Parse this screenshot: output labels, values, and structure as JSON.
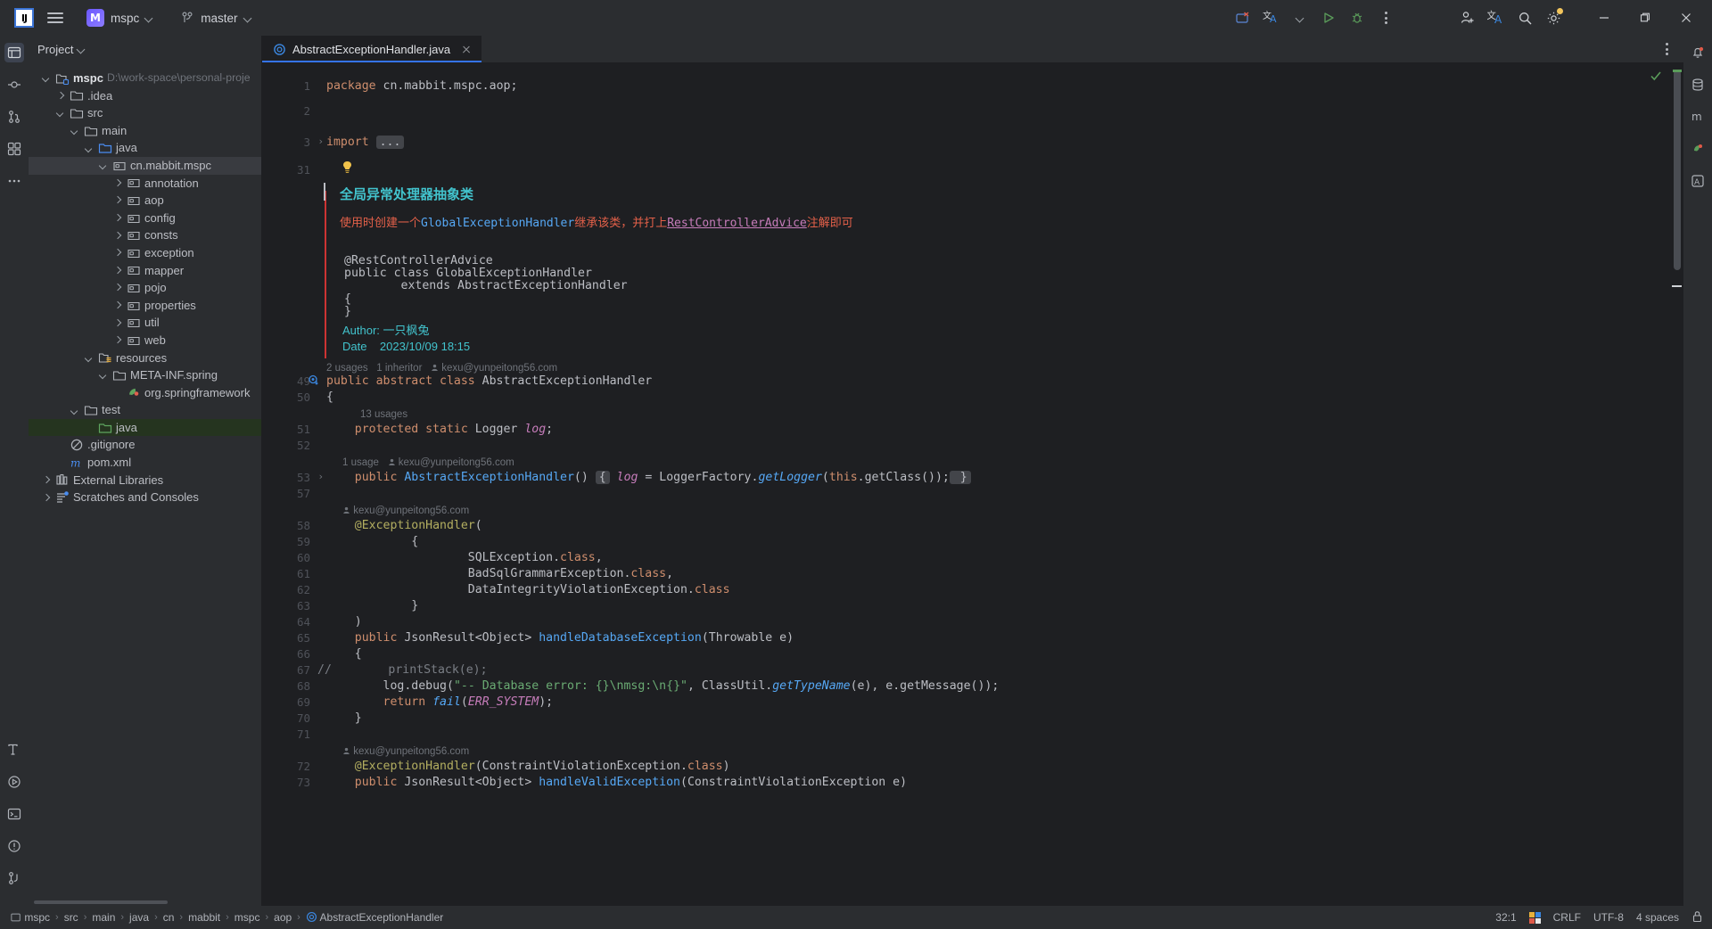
{
  "titlebar": {
    "logo": "IJ",
    "menu_icon": "hamburger-icon",
    "project_initial": "M",
    "project_name": "mspc",
    "branch_icon": "git-branch-icon",
    "branch_name": "master",
    "run_config_icon": "run-config-error-icon",
    "translate_icon": "translate-icon",
    "run_icon": "run-icon",
    "debug_icon": "debug-icon",
    "more_icon": "more-vertical-icon",
    "account_icon": "add-account-icon",
    "search_icon": "search-icon",
    "settings_icon": "gear-icon",
    "minimize": "–",
    "maximize": "❐",
    "close": "✕"
  },
  "leftbar": {
    "items": [
      {
        "name": "project-tool-icon",
        "active": true
      },
      {
        "name": "commit-tool-icon",
        "active": false
      },
      {
        "name": "pull-requests-tool-icon",
        "active": false
      },
      {
        "name": "structure-tool-icon",
        "active": false
      },
      {
        "name": "more-tool-icon",
        "active": false
      }
    ],
    "bottom_items": [
      {
        "name": "terminal-font-icon"
      },
      {
        "name": "services-run-icon"
      },
      {
        "name": "terminal-icon"
      },
      {
        "name": "problems-icon"
      },
      {
        "name": "version-control-icon"
      }
    ]
  },
  "rightbar": {
    "items": [
      {
        "name": "notifications-icon"
      },
      {
        "name": "database-icon"
      },
      {
        "name": "maven-icon"
      },
      {
        "name": "bean-validation-icon"
      },
      {
        "name": "ai-assistant-icon"
      }
    ]
  },
  "project_panel": {
    "title": "Project",
    "tree": [
      {
        "indent": 0,
        "arrow": "open",
        "icon": "module-icon",
        "label": "mspc",
        "bold": true,
        "sub": "D:\\work-space\\personal-proje"
      },
      {
        "indent": 1,
        "arrow": "closed",
        "icon": "folder-icon",
        "label": ".idea"
      },
      {
        "indent": 1,
        "arrow": "open",
        "icon": "folder-icon",
        "label": "src"
      },
      {
        "indent": 2,
        "arrow": "open",
        "icon": "folder-icon",
        "label": "main"
      },
      {
        "indent": 3,
        "arrow": "open",
        "icon": "source-root-icon",
        "label": "java"
      },
      {
        "indent": 4,
        "arrow": "open",
        "icon": "package-icon",
        "label": "cn.mabbit.mspc",
        "selected": true
      },
      {
        "indent": 5,
        "arrow": "closed",
        "icon": "package-icon",
        "label": "annotation"
      },
      {
        "indent": 5,
        "arrow": "closed",
        "icon": "package-icon",
        "label": "aop"
      },
      {
        "indent": 5,
        "arrow": "closed",
        "icon": "package-icon",
        "label": "config"
      },
      {
        "indent": 5,
        "arrow": "closed",
        "icon": "package-icon",
        "label": "consts"
      },
      {
        "indent": 5,
        "arrow": "closed",
        "icon": "package-icon",
        "label": "exception"
      },
      {
        "indent": 5,
        "arrow": "closed",
        "icon": "package-icon",
        "label": "mapper"
      },
      {
        "indent": 5,
        "arrow": "closed",
        "icon": "package-icon",
        "label": "pojo"
      },
      {
        "indent": 5,
        "arrow": "closed",
        "icon": "package-icon",
        "label": "properties"
      },
      {
        "indent": 5,
        "arrow": "closed",
        "icon": "package-icon",
        "label": "util"
      },
      {
        "indent": 5,
        "arrow": "closed",
        "icon": "package-icon",
        "label": "web"
      },
      {
        "indent": 3,
        "arrow": "open",
        "icon": "resource-root-icon",
        "label": "resources"
      },
      {
        "indent": 4,
        "arrow": "open",
        "icon": "folder-icon",
        "label": "META-INF.spring"
      },
      {
        "indent": 5,
        "arrow": "none",
        "icon": "spring-icon",
        "label": "org.springframework"
      },
      {
        "indent": 2,
        "arrow": "open",
        "icon": "folder-icon",
        "label": "test"
      },
      {
        "indent": 3,
        "arrow": "none",
        "icon": "test-root-icon",
        "label": "java",
        "testroot": true
      },
      {
        "indent": 1,
        "arrow": "none",
        "icon": "gitignore-icon",
        "label": ".gitignore"
      },
      {
        "indent": 1,
        "arrow": "none",
        "icon": "maven-file-icon",
        "label": "pom.xml"
      },
      {
        "indent": 0,
        "arrow": "closed",
        "icon": "libraries-icon",
        "label": "External Libraries"
      },
      {
        "indent": 0,
        "arrow": "closed",
        "icon": "scratches-icon",
        "label": "Scratches and Consoles"
      }
    ]
  },
  "editor": {
    "tab": {
      "icon": "java-class-icon",
      "label": "AbstractExceptionHandler.java",
      "close_icon": "close-icon"
    },
    "options_icon": "more-vertical-icon",
    "inspection_ok_icon": "inspection-check-icon",
    "line_numbers": [
      "1",
      "2",
      "3",
      "31",
      "49",
      "50",
      "51",
      "52",
      "53",
      "57",
      "58",
      "59",
      "60",
      "61",
      "62",
      "63",
      "64",
      "65",
      "66",
      "67",
      "68",
      "69",
      "70",
      "71",
      "72",
      "73"
    ],
    "doc": {
      "title": "全局异常处理器抽象类",
      "paragraph_prefix": "使用时创建一个",
      "paragraph_code": "GlobalExceptionHandler",
      "paragraph_mid": "继承该类，并打上",
      "paragraph_link": "RestControllerAdvice",
      "paragraph_suffix": "注解即可",
      "pre": [
        "@RestControllerAdvice",
        "public class GlobalExceptionHandler",
        "        extends AbstractExceptionHandler",
        "{",
        "}"
      ],
      "author_label": "Author:",
      "author_value": "一只枫兔",
      "date_label": "Date",
      "date_value": "2023/10/09 18:15"
    },
    "hints": {
      "class_hint": "2 usages   1 inheritor   ",
      "class_author": "kexu@yunpeitong56.com <kexu@yunpeitong56.com>",
      "log_usages": "13 usages",
      "ctor_usages": "1 usage   ",
      "ctor_author": "kexu@yunpeitong56.com <kexu@yunpeitong56.com>",
      "method_author": "kexu@yunpeitong56.com <kexu@yunpeitong56.com>",
      "method2_author": "kexu@yunpeitong56.com <kexu@yunpeitong56.com>"
    },
    "code_lines": [
      {
        "n": "1",
        "tokens": [
          {
            "t": "package ",
            "c": "kw"
          },
          {
            "t": "cn.mabbit.mspc.aop;",
            "c": "plain"
          }
        ]
      },
      {
        "n": "3",
        "tokens": [
          {
            "t": "import ",
            "c": "kw"
          },
          {
            "t": "...",
            "c": "fold"
          }
        ]
      },
      {
        "n": "49",
        "tokens": [
          {
            "t": "public abstract class ",
            "c": "kw"
          },
          {
            "t": "AbstractExceptionHandler",
            "c": "plain"
          }
        ]
      },
      {
        "n": "50",
        "tokens": [
          {
            "t": "{",
            "c": "plain"
          }
        ]
      },
      {
        "n": "51",
        "tokens": [
          {
            "t": "    protected static ",
            "c": "kw"
          },
          {
            "t": "Logger ",
            "c": "plain"
          },
          {
            "t": "log",
            "c": "fldi"
          },
          {
            "t": ";",
            "c": "plain"
          }
        ]
      },
      {
        "n": "53",
        "tokens": [
          {
            "t": "    public ",
            "c": "kw"
          },
          {
            "t": "AbstractExceptionHandler",
            "c": "mth"
          },
          {
            "t": "() ",
            "c": "plain"
          },
          {
            "t": "{",
            "c": "fold"
          },
          {
            "t": " ",
            "c": "plain"
          },
          {
            "t": "log",
            "c": "fldi"
          },
          {
            "t": " = LoggerFactory.",
            "c": "plain"
          },
          {
            "t": "getLogger",
            "c": "mthi"
          },
          {
            "t": "(",
            "c": "plain"
          },
          {
            "t": "this",
            "c": "kw"
          },
          {
            "t": ".getClass());",
            "c": "plain"
          },
          {
            "t": " }",
            "c": "fold"
          }
        ]
      },
      {
        "n": "58",
        "tokens": [
          {
            "t": "    @ExceptionHandler",
            "c": "ann"
          },
          {
            "t": "(",
            "c": "plain"
          }
        ]
      },
      {
        "n": "59",
        "tokens": [
          {
            "t": "            {",
            "c": "plain"
          }
        ]
      },
      {
        "n": "60",
        "tokens": [
          {
            "t": "                    SQLException.",
            "c": "plain"
          },
          {
            "t": "class",
            "c": "kw"
          },
          {
            "t": ",",
            "c": "plain"
          }
        ]
      },
      {
        "n": "61",
        "tokens": [
          {
            "t": "                    BadSqlGrammarException.",
            "c": "plain"
          },
          {
            "t": "class",
            "c": "kw"
          },
          {
            "t": ",",
            "c": "plain"
          }
        ]
      },
      {
        "n": "62",
        "tokens": [
          {
            "t": "                    DataIntegrityViolationException.",
            "c": "plain"
          },
          {
            "t": "class",
            "c": "kw"
          }
        ]
      },
      {
        "n": "63",
        "tokens": [
          {
            "t": "            }",
            "c": "plain"
          }
        ]
      },
      {
        "n": "64",
        "tokens": [
          {
            "t": "    )",
            "c": "plain"
          }
        ]
      },
      {
        "n": "65",
        "tokens": [
          {
            "t": "    public ",
            "c": "kw"
          },
          {
            "t": "JsonResult<Object> ",
            "c": "plain"
          },
          {
            "t": "handleDatabaseException",
            "c": "mth"
          },
          {
            "t": "(Throwable e)",
            "c": "plain"
          }
        ]
      },
      {
        "n": "66",
        "tokens": [
          {
            "t": "    {",
            "c": "plain"
          }
        ]
      },
      {
        "n": "67",
        "tokens": [
          {
            "t": "//        printStack(e);",
            "c": "cmt"
          }
        ]
      },
      {
        "n": "68",
        "tokens": [
          {
            "t": "        log.",
            "c": "plain"
          },
          {
            "t": "debug",
            "c": "plain"
          },
          {
            "t": "(",
            "c": "plain"
          },
          {
            "t": "\"-- Database error: {}\\nmsg:\\n{}\"",
            "c": "str"
          },
          {
            "t": ", ClassUtil.",
            "c": "plain"
          },
          {
            "t": "getTypeName",
            "c": "mthi"
          },
          {
            "t": "(e), e.getMessage());",
            "c": "plain"
          }
        ]
      },
      {
        "n": "69",
        "tokens": [
          {
            "t": "        return ",
            "c": "kw"
          },
          {
            "t": "fail",
            "c": "mthi"
          },
          {
            "t": "(",
            "c": "plain"
          },
          {
            "t": "ERR_SYSTEM",
            "c": "consti"
          },
          {
            "t": ");",
            "c": "plain"
          }
        ]
      },
      {
        "n": "70",
        "tokens": [
          {
            "t": "    }",
            "c": "plain"
          }
        ]
      },
      {
        "n": "72",
        "tokens": [
          {
            "t": "    @ExceptionHandler",
            "c": "ann"
          },
          {
            "t": "(ConstraintViolationException.",
            "c": "plain"
          },
          {
            "t": "class",
            "c": "kw"
          },
          {
            "t": ")",
            "c": "plain"
          }
        ]
      },
      {
        "n": "73",
        "tokens": [
          {
            "t": "    public ",
            "c": "kw"
          },
          {
            "t": "JsonResult<Object> ",
            "c": "plain"
          },
          {
            "t": "handleValidException",
            "c": "mth"
          },
          {
            "t": "(ConstraintViolationException e)",
            "c": "plain"
          }
        ]
      }
    ]
  },
  "statusbar": {
    "breadcrumbs": [
      "mspc",
      "src",
      "main",
      "java",
      "cn",
      "mabbit",
      "mspc",
      "aop",
      "AbstractExceptionHandler"
    ],
    "module_icon": "module-icon",
    "class_icon": "java-class-icon",
    "caret_position": "32:1",
    "keyboard_icon": "keyboard-layout-icon",
    "line_separator": "CRLF",
    "encoding": "UTF-8",
    "indent": "4 spaces",
    "lock_icon": "lock-icon"
  },
  "colors": {
    "accent": "#3574f0",
    "panel_bg": "#2b2d30",
    "editor_bg": "#1e1f22",
    "text": "#bcbec4",
    "doc_title": "#42c3cd",
    "error_red": "#cc3333",
    "test_root_green": "#25341f"
  }
}
